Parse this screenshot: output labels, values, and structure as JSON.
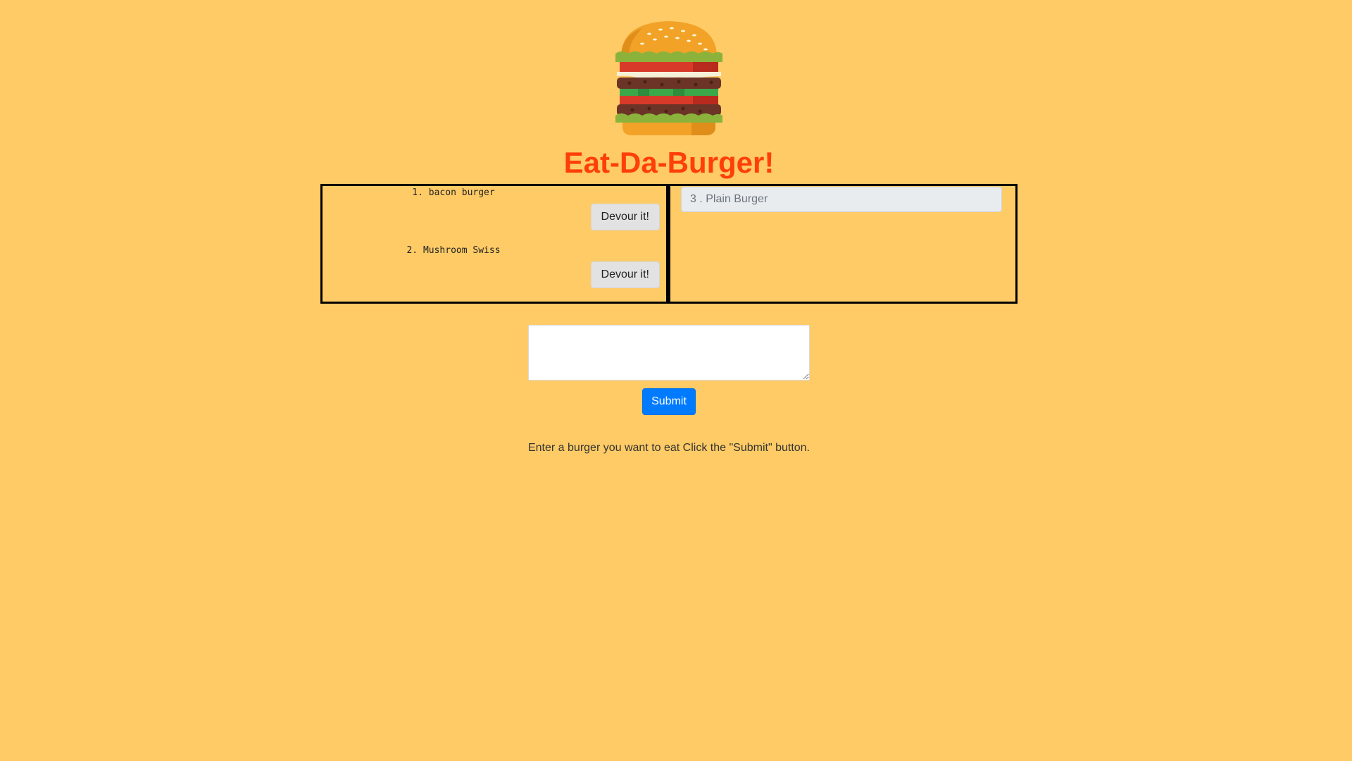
{
  "header": {
    "logo": "burger-logo",
    "title": "Eat-Da-Burger!"
  },
  "uneaten": {
    "items": [
      {
        "label": "1. bacon burger",
        "button": "Devour it!"
      },
      {
        "label": "2. Mushroom Swiss",
        "button": "Devour it!"
      }
    ]
  },
  "devoured": {
    "items": [
      {
        "label": "3 . Plain Burger"
      }
    ]
  },
  "form": {
    "input_value": "",
    "input_placeholder": "",
    "submit_label": "Submit",
    "instructions": "Enter a burger you want to eat Click the \"Submit\" button."
  },
  "colors": {
    "background": "#ffcb66",
    "title": "#ff3f0a",
    "submit": "#007bff"
  }
}
